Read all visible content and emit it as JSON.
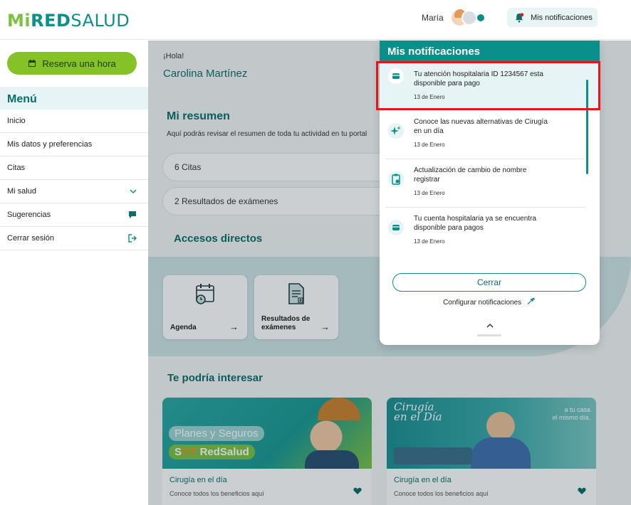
{
  "header": {
    "logo_mi": "Mi",
    "logo_red": "RED",
    "logo_salud": "SALUD",
    "user_name": "María",
    "notifications_label": "Mis notificaciones"
  },
  "sidebar": {
    "reserve_label": "Reserva una hora",
    "menu_title": "Menú",
    "items": [
      {
        "label": "Inicio"
      },
      {
        "label": "Mis datos y preferencias"
      },
      {
        "label": "Citas"
      },
      {
        "label": "Mi salud"
      },
      {
        "label": "Sugerencias"
      },
      {
        "label": "Cerrar sesión"
      }
    ]
  },
  "main": {
    "greeting": "¡Hola!",
    "user_full_name": "Carolina Martínez",
    "summary_title": "Mi resumen",
    "summary_desc": "Aquí podrás revisar el resumen de toda tu actividad en tu portal",
    "summary_cards": [
      {
        "label": "6 Citas"
      },
      {
        "label": "2 Resultados de exámenes"
      }
    ],
    "shortcuts_title": "Accesos directos",
    "shortcuts": [
      {
        "label": "Agenda"
      },
      {
        "label_line1": "Resultados de",
        "label_line2": "exámenes"
      }
    ],
    "interest_title": "Te podría interesar",
    "promos": [
      {
        "image_line1": "Planes y Seguros",
        "image_line2_a": "S",
        "image_line2_b": "OY",
        "image_line2_c": " RedSalud",
        "caption": "Cirugía en el día",
        "sub": "Conoce todos los beneficios aquí"
      },
      {
        "image_line1": "Cirugía",
        "image_line2": "en el Día",
        "image_right1": "a tu casa",
        "image_right2": "el mismo día.",
        "caption": "Cirugía en el día",
        "sub": "Conoce todos los beneficios aquí"
      }
    ]
  },
  "notifications_panel": {
    "title": "Mis notificaciones",
    "items": [
      {
        "line1": "Tu atención hospitalaria  ID 1234567 esta",
        "line2": "disponible para pago",
        "date": "13 de Enero",
        "icon": "wallet-icon"
      },
      {
        "line1": "Conoce las nuevas alternativas de Cirugía",
        "line2": "en un día",
        "date": "13 de Enero",
        "icon": "sparkle-icon"
      },
      {
        "line1": "Actualización de cambio de nombre",
        "line2": "registrar",
        "date": "13 de Enero",
        "icon": "clipboard-icon"
      },
      {
        "line1": "Tu cuenta hospitalaria ya se encuentra",
        "line2": "disponible para pagos",
        "date": "13 de Enero",
        "icon": "wallet-icon"
      }
    ],
    "close_label": "Cerrar",
    "config_label": "Configurar notificaciones"
  },
  "colors": {
    "brand_teal": "#0a8f8a",
    "brand_green": "#84c225",
    "highlight_red": "#e3161c"
  }
}
